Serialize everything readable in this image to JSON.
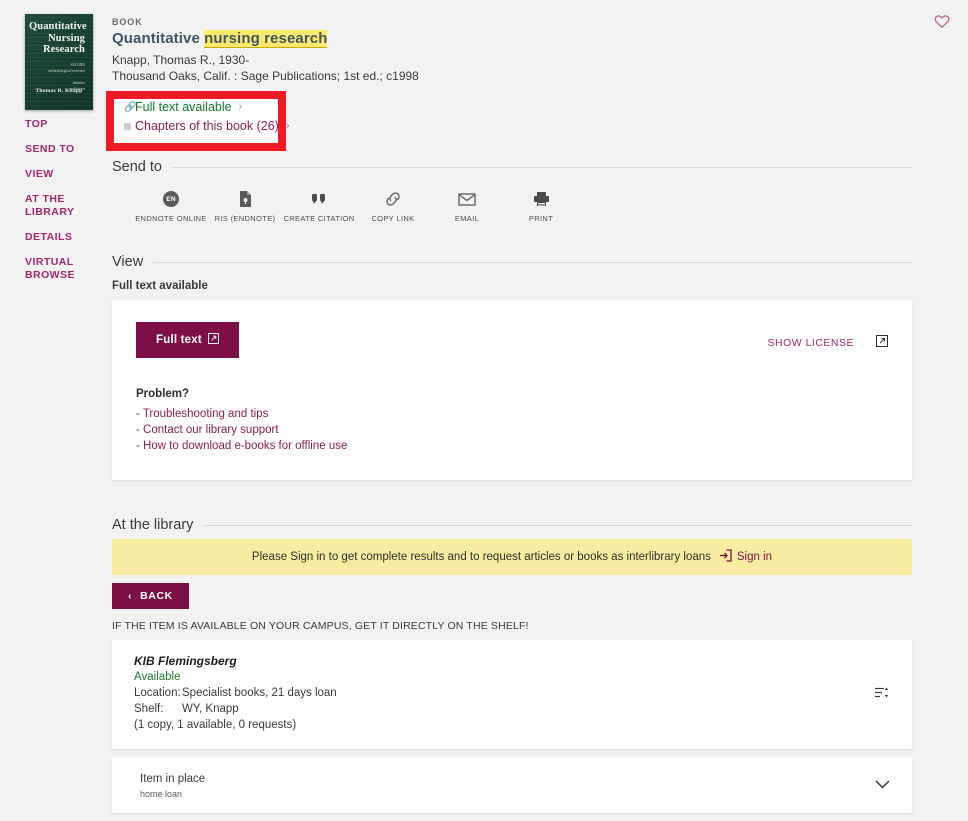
{
  "record": {
    "kind": "BOOK",
    "title_plain": "Quantitative ",
    "title_highlight": "nursing research",
    "author": "Knapp, Thomas R., 1930-",
    "publication": "Thousand Oaks, Calif. : Sage Publications; 1st ed.; c1998",
    "cover": {
      "line1": "Quantitative",
      "line2": "Nursing",
      "line3": "Research",
      "sub1": "SECOND",
      "sub2": "methodological overview",
      "sub3": "statistics",
      "sub4": "worksheets",
      "author": "Thomas R. Knapp"
    },
    "favorite_icon": "heart-icon"
  },
  "quick_links": [
    {
      "label": "Full text available",
      "icon": "link-icon",
      "color": "#0f7a28"
    },
    {
      "label": "Chapters of this book (26)",
      "icon": "square-icon",
      "color": "#8c1d55"
    }
  ],
  "sidebar": {
    "items": [
      {
        "label": "TOP"
      },
      {
        "label": "SEND TO"
      },
      {
        "label": "VIEW"
      },
      {
        "label": "AT THE LIBRARY"
      },
      {
        "label": "DETAILS"
      },
      {
        "label": "VIRTUAL BROWSE"
      }
    ]
  },
  "send_to": {
    "heading": "Send to",
    "actions": [
      {
        "label": "ENDNOTE ONLINE",
        "icon": "endnote-icon",
        "badge": "EN"
      },
      {
        "label": "RIS (ENDNOTE)",
        "icon": "file-icon"
      },
      {
        "label": "CREATE CITATION",
        "icon": "quote-icon"
      },
      {
        "label": "COPY LINK",
        "icon": "link-icon"
      },
      {
        "label": "EMAIL",
        "icon": "envelope-icon"
      },
      {
        "label": "PRINT",
        "icon": "printer-icon"
      }
    ]
  },
  "view": {
    "heading": "View",
    "subheading": "Full text available",
    "full_text_button": "Full text",
    "show_license": "SHOW LICENSE",
    "problem_heading": "Problem?",
    "problem_links": [
      "- Troubleshooting and tips",
      "- Contact our library support",
      "- How to download e-books for offline use"
    ]
  },
  "at_the_library": {
    "heading": "At the library",
    "banner_text": "Please Sign in to get complete results and to request articles or books as interlibrary loans",
    "sign_in_label": "Sign in",
    "back_label": "BACK",
    "shelf_note": "IF THE ITEM IS AVAILABLE ON YOUR CAMPUS, GET IT DIRECTLY ON THE SHELF!",
    "holding": {
      "library": "KIB Flemingsberg",
      "availability": "Available",
      "location_key": "Location:",
      "location_value": "Specialist books, 21 days loan",
      "shelf_key": "Shelf:",
      "shelf_value": "WY, Knapp",
      "copies": "(1 copy, 1 available, 0 requests)"
    },
    "item": {
      "status": "Item in place",
      "policy": "home loan"
    }
  },
  "colors": {
    "accent": "#7c0f45",
    "link": "#8c1d55",
    "nav": "#a4266b",
    "available": "#1d7a2e",
    "highlight": "#ffe96b",
    "banner": "#f6eda0",
    "annotation_box": "#ef1a24",
    "title": "#3c5866",
    "page_bg": "#f2f2f2"
  }
}
